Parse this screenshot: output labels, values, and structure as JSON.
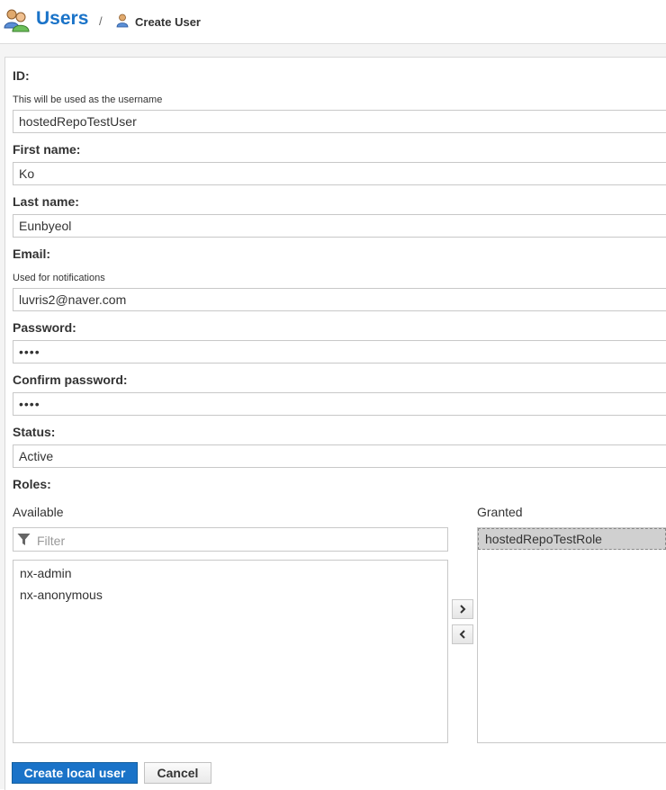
{
  "header": {
    "title": "Users",
    "separator": "/",
    "breadcrumb": "Create User"
  },
  "form": {
    "id": {
      "label": "ID:",
      "help": "This will be used as the username",
      "value": "hostedRepoTestUser"
    },
    "first_name": {
      "label": "First name:",
      "value": "Ko"
    },
    "last_name": {
      "label": "Last name:",
      "value": "Eunbyeol"
    },
    "email": {
      "label": "Email:",
      "help": "Used for notifications",
      "value": "luvris2@naver.com"
    },
    "password": {
      "label": "Password:",
      "value": "••••"
    },
    "confirm_password": {
      "label": "Confirm password:",
      "value": "••••"
    },
    "status": {
      "label": "Status:",
      "value": "Active"
    },
    "roles": {
      "label": "Roles:",
      "available_label": "Available",
      "granted_label": "Granted",
      "filter_placeholder": "Filter",
      "available": [
        "nx-admin",
        "nx-anonymous"
      ],
      "granted": [
        "hostedRepoTestRole"
      ]
    }
  },
  "buttons": {
    "create": "Create local user",
    "cancel": "Cancel"
  },
  "colors": {
    "accent": "#1a73c8"
  }
}
